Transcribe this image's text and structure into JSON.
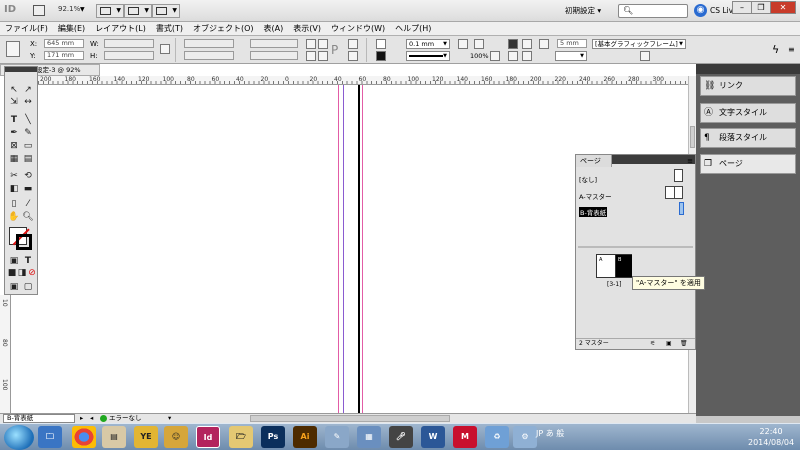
{
  "appbar": {
    "zoom": "92.1%",
    "workspace": "初期設定 ▾",
    "search_placeholder": "",
    "cslive": "CS Live",
    "logo": "ID"
  },
  "menu": [
    "ファイル(F)",
    "編集(E)",
    "レイアウト(L)",
    "書式(T)",
    "オブジェクト(O)",
    "表(A)",
    "表示(V)",
    "ウィンドウ(W)",
    "ヘルプ(H)"
  ],
  "control": {
    "x_label": "X:",
    "y_label": "Y:",
    "w_label": "W:",
    "h_label": "H:",
    "x_value": "645 mm",
    "y_value": "171 mm",
    "stroke_weight": "0.1 mm",
    "percent": "100%",
    "size_field": "5 mm",
    "frame_style": "[基本グラフィックフレーム]"
  },
  "document": {
    "tab_title": "称未設定-3 @ 92%",
    "ruler_ticks": [
      "200",
      "180",
      "160",
      "140",
      "120",
      "100",
      "80",
      "60",
      "40",
      "20",
      "0",
      "20",
      "40",
      "60",
      "80",
      "100",
      "120",
      "140",
      "160",
      "180",
      "200",
      "220",
      "240",
      "260",
      "280",
      "300"
    ],
    "vruler_ticks": [
      "10",
      "80",
      "100"
    ]
  },
  "dock": {
    "items": [
      {
        "label": "リンク",
        "icon": "link-icon"
      },
      {
        "label": "文字スタイル",
        "icon": "character-style-icon"
      },
      {
        "label": "段落スタイル",
        "icon": "paragraph-style-icon"
      },
      {
        "label": "ページ",
        "icon": "pages-icon"
      }
    ]
  },
  "pages_panel": {
    "title": "ページ",
    "master_none": "[なし]",
    "master_a": "A-マスター",
    "master_b": "B-背表紙",
    "spread_label": "[3-1]",
    "spread_a_letter": "A",
    "spread_page_letter": "B",
    "footer": "2 マスター",
    "tooltip": "\"A-マスター\" を適用"
  },
  "status": {
    "page": "B-背表紙",
    "preflight": "エラーなし"
  },
  "taskbar": {
    "apps": [
      "chrome",
      "explorer",
      "game",
      "indesign",
      "folder",
      "photoshop",
      "illustrator",
      "paint",
      "network",
      "mic",
      "word",
      "mcafee",
      "recycle",
      "other"
    ],
    "tray": "JP あ 般",
    "time": "22:40",
    "date": "2014/08/04"
  },
  "colors": {
    "pink_margin": "#e25ca6",
    "purple_margin": "#8a5bd0",
    "indesign": "#b3245e",
    "photoshop": "#0b2f5c",
    "illustrator": "#4d2b00"
  }
}
